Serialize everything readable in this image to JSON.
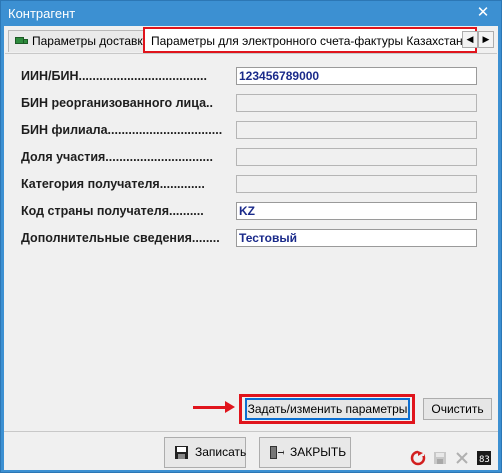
{
  "window": {
    "title": "Контрагент",
    "close_glyph": "✕"
  },
  "tabs": [
    {
      "label": "Параметры доставки",
      "icon": "truck-icon",
      "active": false
    },
    {
      "label": "Параметры для электронного счета-фактуры Казахстана",
      "active": true
    }
  ],
  "tab_scroll": {
    "left": "◀",
    "right": "▶"
  },
  "fields": [
    {
      "label": "ИИН/БИН.....................................",
      "value": "123456789000"
    },
    {
      "label": "БИН реорганизованного лица..",
      "value": ""
    },
    {
      "label": "БИН филиала.................................",
      "value": ""
    },
    {
      "label": "Доля участия...............................",
      "value": ""
    },
    {
      "label": "Категория получателя.............",
      "value": ""
    },
    {
      "label": "Код страны получателя..........",
      "value": "KZ"
    },
    {
      "label": "Дополнительные сведения........",
      "value": "Тестовый"
    }
  ],
  "buttons": {
    "set_params": "Задать/изменить параметры",
    "clear": "Очистить",
    "save": "Записать",
    "close": "ЗАКРЫТЬ"
  },
  "status_icons": [
    "refresh-icon",
    "disk-icon",
    "cancel-icon",
    "counter-icon"
  ],
  "colors": {
    "titlebar": "#3c90d2",
    "highlight": "#e0141c",
    "value_text": "#1a2a8a"
  }
}
